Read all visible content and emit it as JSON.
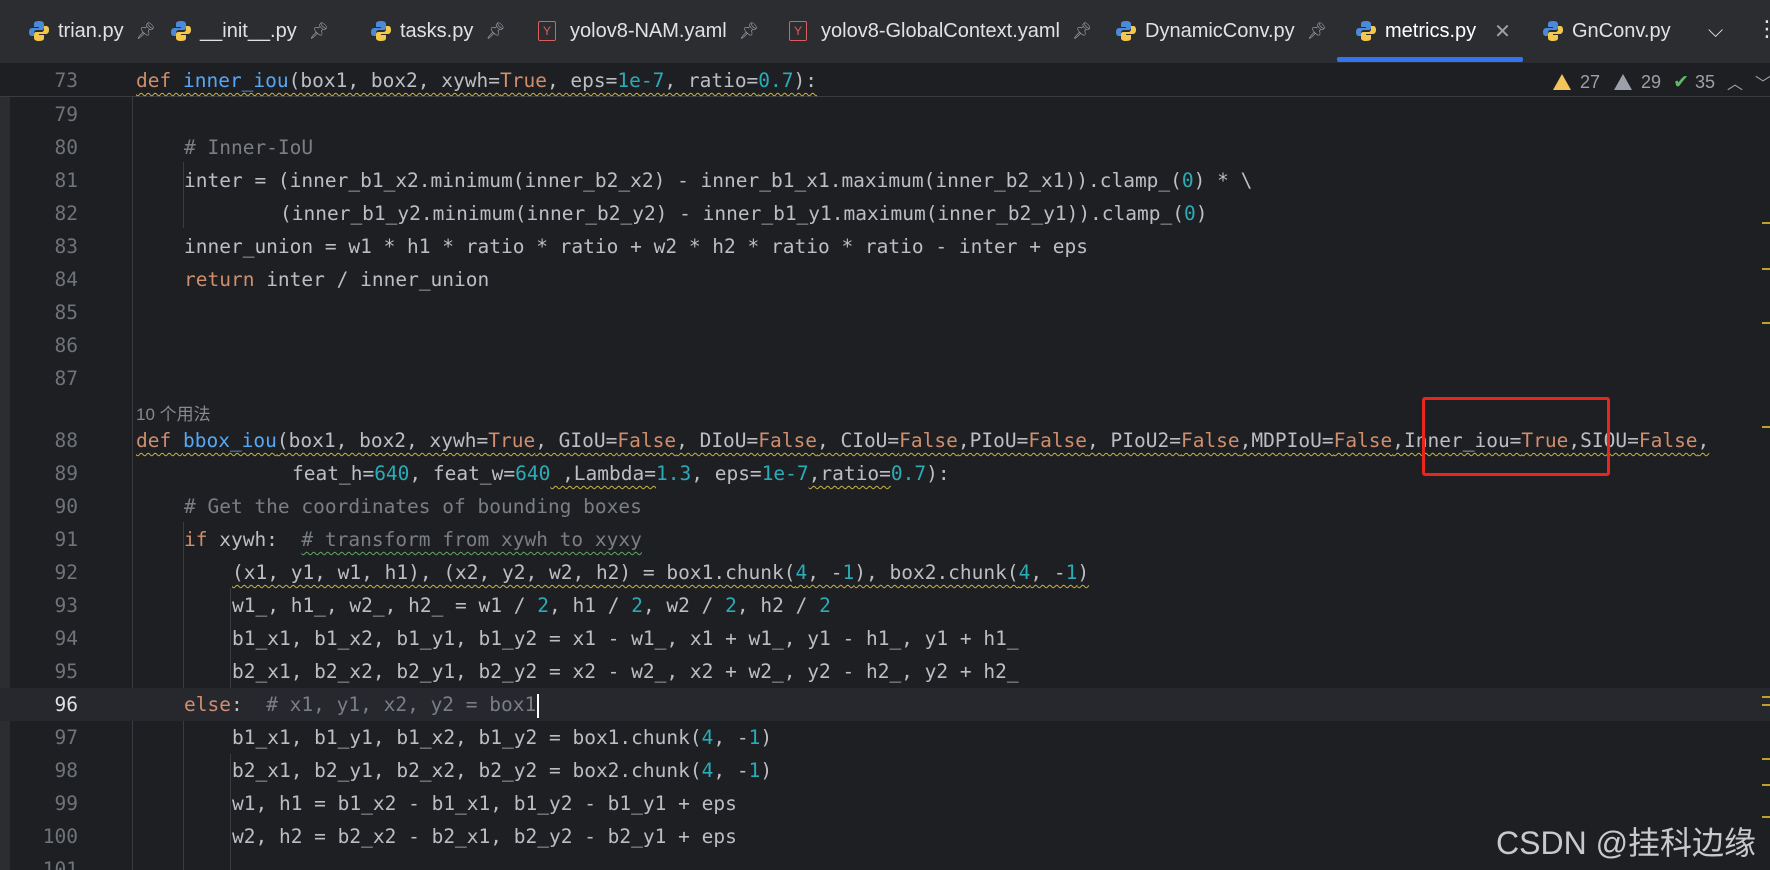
{
  "tabs": [
    {
      "label": "trian.py",
      "type": "python",
      "pinned": true
    },
    {
      "label": "__init__.py",
      "type": "python",
      "pinned": true
    },
    {
      "label": "tasks.py",
      "type": "python",
      "pinned": true
    },
    {
      "label": "yolov8-NAM.yaml",
      "type": "yaml",
      "pinned": true
    },
    {
      "label": "yolov8-GlobalContext.yaml",
      "type": "yaml",
      "pinned": true
    },
    {
      "label": "DynamicConv.py",
      "type": "python",
      "pinned": true
    },
    {
      "label": "metrics.py",
      "type": "python",
      "active": true,
      "closable": true
    },
    {
      "label": "GnConv.py",
      "type": "python"
    }
  ],
  "tab_icons": {
    "pin": "pin-icon",
    "close": "close-icon",
    "overflow": "chevron-down-icon",
    "more": "more-vertical-icon",
    "yaml_glyph": "Y"
  },
  "inspections": {
    "warnings": "27",
    "weak_warnings": "29",
    "passed": "35"
  },
  "colors": {
    "accent": "#3574f0",
    "annotation": "#e8261d",
    "keyword": "#cf8e6d",
    "function": "#56a8f5",
    "number": "#2aacb8",
    "comment": "#7a7e85"
  },
  "usage_hint": "10 个用法",
  "lines": {
    "n73": "73",
    "n79": "79",
    "n80": "80",
    "n81": "81",
    "n82": "82",
    "n83": "83",
    "n84": "84",
    "n85": "85",
    "n86": "86",
    "n87": "87",
    "n88": "88",
    "n89": "89",
    "n90": "90",
    "n91": "91",
    "n92": "92",
    "n93": "93",
    "n94": "94",
    "n95": "95",
    "n96": "96",
    "n97": "97",
    "n98": "98",
    "n99": "99",
    "n100": "100",
    "n101": "101"
  },
  "code": {
    "l73": {
      "kw": "def",
      "fn": "inner_iou",
      "a": "(box1, box2, xywh=",
      "t": "True",
      "b": ", eps=",
      "n1": "1e-7",
      "c": ", ratio=",
      "n2": "0.7",
      "d": "):"
    },
    "l80": "# Inner-IoU",
    "l81": {
      "a": "inter = (inner_b1_x2.minimum(inner_b2_x2) - inner_b1_x1.maximum(inner_b2_x1)).clamp_(",
      "n": "0",
      "b": ") * \\"
    },
    "l82": {
      "a": "(inner_b1_y2.minimum(inner_b2_y2) - inner_b1_y1.maximum(inner_b2_y1)).clamp_(",
      "n": "0",
      "b": ")"
    },
    "l83": "inner_union = w1 * h1 * ratio * ratio + w2 * h2 * ratio * ratio - inter + eps",
    "l84": {
      "kw": "return",
      "a": " inter / inner_union"
    },
    "l88": {
      "kw": "def",
      "fn": "bbox_iou",
      "a": "(box1, box2, xywh=",
      "t1": "True",
      "b": ", GIoU=",
      "f1": "False",
      "c": ", DIoU=",
      "f2": "False",
      "d": ", CIoU=",
      "f3": "False",
      "e": ",PIoU=",
      "f4": "False",
      "f": ", PIoU2=",
      "f5": "False",
      "g": ",MDPIoU=",
      "f6": "False",
      "h": ",Inner_iou=",
      "t2": "True",
      "i": ",SIOU=",
      "f7": "False",
      "j": ","
    },
    "l89": {
      "a": "feat_h=",
      "n1": "640",
      "b": ", feat_w=",
      "n2": "640",
      "c": " ,Lambda=",
      "n3": "1.3",
      "d": ", eps=",
      "n4": "1e-7",
      "e": ",ratio=",
      "n5": "0.7",
      "f": "):"
    },
    "l90": "# Get the coordinates of bounding boxes",
    "l91": {
      "kw": "if",
      "a": " xywh:  ",
      "cm": "# transform from xywh to xyxy"
    },
    "l92": {
      "a": "(x1, y1, w1, h1), (x2, y2, w2, h2) = box1.chunk(",
      "n1": "4",
      "b": ", -",
      "n2": "1",
      "c": "), box2.chunk(",
      "n3": "4",
      "d": ", -",
      "n4": "1",
      "e": ")"
    },
    "l93": {
      "a": "w1_, h1_, w2_, h2_ = w1 / ",
      "n1": "2",
      "b": ", h1 / ",
      "n2": "2",
      "c": ", w2 / ",
      "n3": "2",
      "d": ", h2 / ",
      "n4": "2"
    },
    "l94": "b1_x1, b1_x2, b1_y1, b1_y2 = x1 - w1_, x1 + w1_, y1 - h1_, y1 + h1_",
    "l95": "b2_x1, b2_x2, b2_y1, b2_y2 = x2 - w2_, x2 + w2_, y2 - h2_, y2 + h2_",
    "l96": {
      "kw": "else",
      "a": ":  ",
      "cm": "# x1, y1, x2, y2 = box1"
    },
    "l97": {
      "a": "b1_x1, b1_y1, b1_x2, b1_y2 = box1.chunk(",
      "n1": "4",
      "b": ", -",
      "n2": "1",
      "c": ")"
    },
    "l98": {
      "a": "b2_x1, b2_y1, b2_x2, b2_y2 = box2.chunk(",
      "n1": "4",
      "b": ", -",
      "n2": "1",
      "c": ")"
    },
    "l99": "w1, h1 = b1_x2 - b1_x1, b1_y2 - b1_y1 + eps",
    "l100": "w2, h2 = b2_x2 - b2_x1, b2_y2 - b2_y1 + eps"
  },
  "watermark": "CSDN @挂科边缘"
}
